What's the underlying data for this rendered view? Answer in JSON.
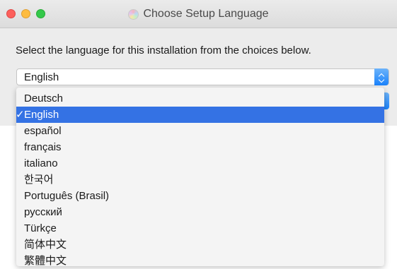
{
  "window": {
    "title": "Choose Setup Language"
  },
  "dialog": {
    "instruction": "Select the language for this installation from the choices below.",
    "language_select": {
      "selected_value": "English"
    }
  },
  "dropdown": {
    "items": [
      {
        "label": "Deutsch",
        "selected": false
      },
      {
        "label": "English",
        "selected": true,
        "check": "✓"
      },
      {
        "label": "español",
        "selected": false
      },
      {
        "label": "français",
        "selected": false
      },
      {
        "label": "italiano",
        "selected": false
      },
      {
        "label": "한국어",
        "selected": false
      },
      {
        "label": "Português (Brasil)",
        "selected": false
      },
      {
        "label": "русский",
        "selected": false
      },
      {
        "label": "Türkçe",
        "selected": false
      },
      {
        "label": "简体中文",
        "selected": false
      },
      {
        "label": "繁體中文",
        "selected": false
      }
    ]
  },
  "colors": {
    "accent": "#3472e4",
    "window_bg": "#ececec"
  },
  "icons": {
    "title_icon": "disc-icon",
    "stepper_icon": "up-down-chevron-icon"
  }
}
